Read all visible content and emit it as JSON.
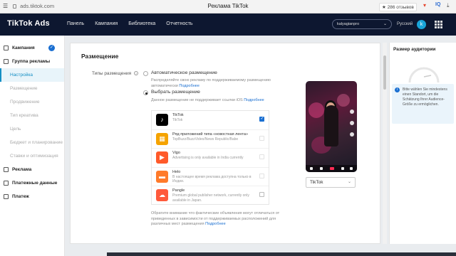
{
  "browser": {
    "url": "ads.tiktok.com",
    "window_title": "Реклама TikTok",
    "reviews_badge": "★ 286 отзывов"
  },
  "header": {
    "logo": "TikTok Ads",
    "nav": [
      "Панель",
      "Кампания",
      "Библиотека",
      "Отчетность"
    ],
    "account": "kalyagianpro",
    "language": "Русский",
    "avatar_letter": "k"
  },
  "sidebar": {
    "items": [
      {
        "label": "Кампания",
        "level": "top",
        "done": true
      },
      {
        "label": "Группа рекламы",
        "level": "top"
      },
      {
        "label": "Настройка",
        "level": "sub",
        "active": true
      },
      {
        "label": "Размещение",
        "level": "sub"
      },
      {
        "label": "Продвижение",
        "level": "sub"
      },
      {
        "label": "Тип креатива",
        "level": "sub"
      },
      {
        "label": "Цель",
        "level": "sub"
      },
      {
        "label": "Бюджет и планирование",
        "level": "sub"
      },
      {
        "label": "Ставки и оптимизация",
        "level": "sub"
      },
      {
        "label": "Реклама",
        "level": "top"
      },
      {
        "label": "Платежные данные",
        "level": "top"
      },
      {
        "label": "Платеж",
        "level": "top"
      }
    ]
  },
  "placement": {
    "title": "Размещение",
    "types_label": "Типы размещения",
    "auto_label": "Автоматическое размещение",
    "auto_desc": "Распределяйте свою рекламу по поддерживаемому размещению автоматически",
    "auto_desc_link": "Подробнее",
    "manual_label": "Выбрать размещение",
    "manual_desc": "Данное размещение не поддерживает ссылки iOS",
    "manual_desc_link": "Подробнее",
    "platforms": [
      {
        "name": "TikTok",
        "sub": "TikTok",
        "checked": true,
        "icon": "tiktok-icon",
        "color": "#000000"
      },
      {
        "name": "Ряд приложений типа «новостная лента»",
        "sub": "TopBuzz/BuzzVideo/News Republic/Babe",
        "checked": false,
        "icon": "newsfeed-icon",
        "color": "#f5a300"
      },
      {
        "name": "Vigo",
        "sub": "Advertising is only available in India currently",
        "checked": false,
        "icon": "vigo-icon",
        "color": "#ff5a2a"
      },
      {
        "name": "Helo",
        "sub": "В настоящее время реклама доступна только в Индии.",
        "checked": false,
        "icon": "helo-icon",
        "color": "#ff7a2a"
      },
      {
        "name": "Pangle",
        "sub": "Premium global publisher network, currently only available in Japan.",
        "checked": false,
        "icon": "pangle-icon",
        "color": "#ff5a3c"
      }
    ],
    "footnote": "Обратите внимание что фактические объявления могут отличаться от приведенных в зависимости от поддерживаемых расположений для различных мест размещения",
    "footnote_link": "Подробнее",
    "preview_select": "TikTok"
  },
  "audience": {
    "title": "Размер аудитории",
    "info": "Bitte wählen Sie mindestens einen Standort, um die Schätzung Ihrer Audience-Größe zu ermöglichen."
  },
  "colors": {
    "header_bg": "#0d1730",
    "accent": "#1a6fd1",
    "active_nav": "#158fc4"
  }
}
